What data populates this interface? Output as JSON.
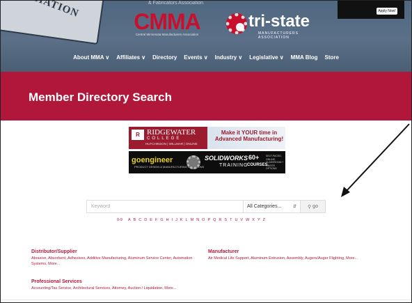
{
  "header": {
    "association_badge": "ASSOCIATION",
    "top_tagline": "& Fabricators Association",
    "cmma_logo": "CMMA",
    "cmma_sub": "Central Minnesota Manufacturers Association",
    "tristate_logo": "tri-state",
    "tristate_sub": "MANUFACTURERS ASSOCIATION",
    "apply_button": "Apply Now!"
  },
  "nav": {
    "items": [
      {
        "label": "About MMA ∨"
      },
      {
        "label": "Affiliates ∨"
      },
      {
        "label": "Directory"
      },
      {
        "label": "Events ∨"
      },
      {
        "label": "Industry ∨"
      },
      {
        "label": "Legislative ∨"
      },
      {
        "label": "MMA Blog"
      },
      {
        "label": "Store"
      }
    ]
  },
  "banner": {
    "title": "Member Directory Search"
  },
  "ads": {
    "ridgewater": {
      "logo_mark": "R",
      "name": "RIDGEWATER",
      "college": "COLLEGE",
      "locations": "HUTCHINSON | WILLMAR | ONLINE",
      "tagline": "Make it YOUR time in Advanced Manufacturing!"
    },
    "goengineer": {
      "brand": "goengineer",
      "brand_sub": "PRODUCT DESIGN & MANUFACTURING SOLUTIONS",
      "product": "SOLIDWORKS",
      "training": "TRAINING",
      "count": "60+",
      "courses": "COURSES",
      "note": "SELF-PACED, ONLINE, CLASSROOM + ONSITE OPTIONS"
    }
  },
  "search": {
    "placeholder": "Keyword",
    "category_value": "All Categories...",
    "go_label": "go"
  },
  "letters": [
    "0-9",
    "A",
    "B",
    "C",
    "D",
    "E",
    "F",
    "G",
    "H",
    "I",
    "J",
    "K",
    "L",
    "M",
    "N",
    "O",
    "P",
    "Q",
    "R",
    "S",
    "T",
    "U",
    "V",
    "W",
    "X",
    "Y",
    "Z"
  ],
  "categories": {
    "distributor": {
      "title": "Distributor/Supplier",
      "links": "Abrasive, Absorbent, Adhesives, Additive Manufacturing, Aluminum Service Center, Automation Systems, More..."
    },
    "manufacturer": {
      "title": "Manufacturer",
      "links": "Air Medical Life Support, Aluminum Extrusion, Assembly, Augers/Auger Flighting, More..."
    },
    "professional": {
      "title": "Professional Services",
      "links": "Accounting/Tax Service, Architectural Services, Attorney, Auction / Liquidation, More..."
    }
  },
  "colors": {
    "brand_red": "#b0173a",
    "header_blue": "#55697f"
  }
}
